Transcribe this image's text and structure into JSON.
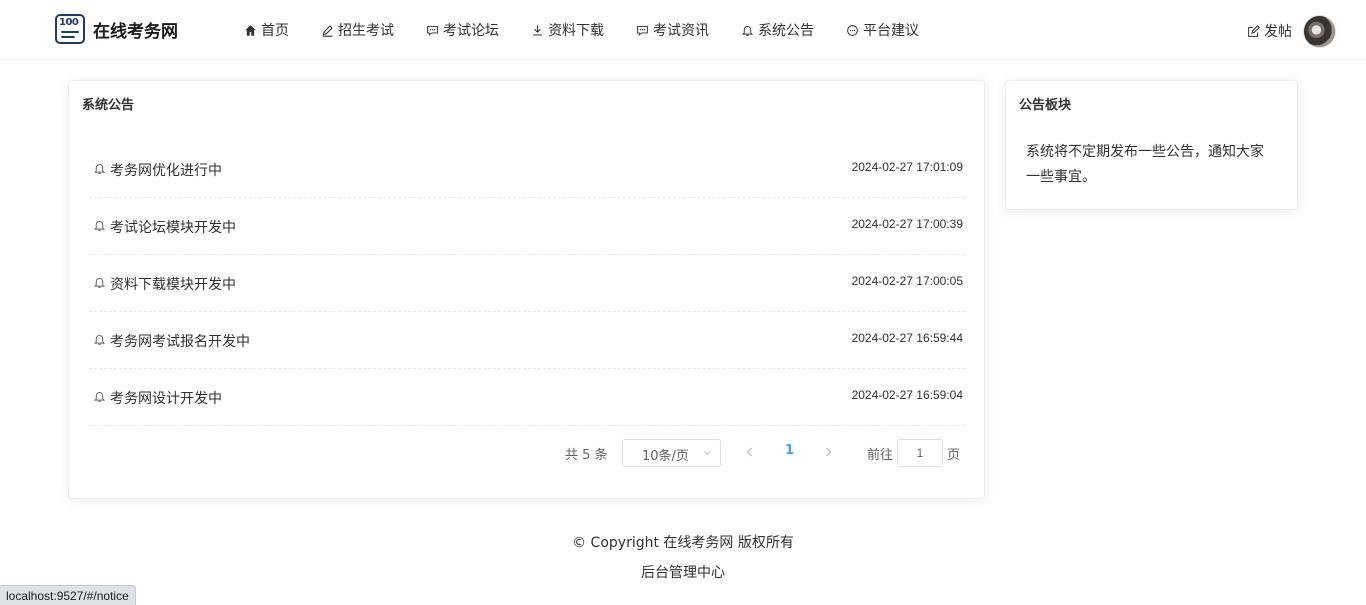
{
  "header": {
    "logo_text": "在线考务网",
    "logo_mark": "100",
    "nav": [
      {
        "label": "首页",
        "icon": "home-icon"
      },
      {
        "label": "招生考试",
        "icon": "edit-icon"
      },
      {
        "label": "考试论坛",
        "icon": "chat-icon"
      },
      {
        "label": "资料下载",
        "icon": "download-icon"
      },
      {
        "label": "考试资讯",
        "icon": "chat-icon"
      },
      {
        "label": "系统公告",
        "icon": "bell-icon"
      },
      {
        "label": "平台建议",
        "icon": "message-icon"
      }
    ],
    "post_label": "发帖"
  },
  "main": {
    "title": "系统公告",
    "notices": [
      {
        "title": "考务网优化进行中",
        "time": "2024-02-27 17:01:09"
      },
      {
        "title": "考试论坛模块开发中",
        "time": "2024-02-27 17:00:39"
      },
      {
        "title": "资料下载模块开发中",
        "time": "2024-02-27 17:00:05"
      },
      {
        "title": "考务网考试报名开发中",
        "time": "2024-02-27 16:59:44"
      },
      {
        "title": "考务网设计开发中",
        "time": "2024-02-27 16:59:04"
      }
    ],
    "pagination": {
      "total": "共 5 条",
      "page_size": "10条/页",
      "current_page": "1",
      "goto_label": "前往",
      "goto_value": "1",
      "page_unit": "页"
    }
  },
  "side": {
    "title": "公告板块",
    "text": "系统将不定期发布一些公告，通知大家一些事宜。"
  },
  "footer": {
    "copyright": "© Copyright 在线考务网 版权所有",
    "admin_link": "后台管理中心"
  },
  "status_bar": {
    "url": "localhost:9527/#/notice"
  },
  "colors": {
    "accent": "#409eff",
    "logo": "#1f3a6e"
  }
}
